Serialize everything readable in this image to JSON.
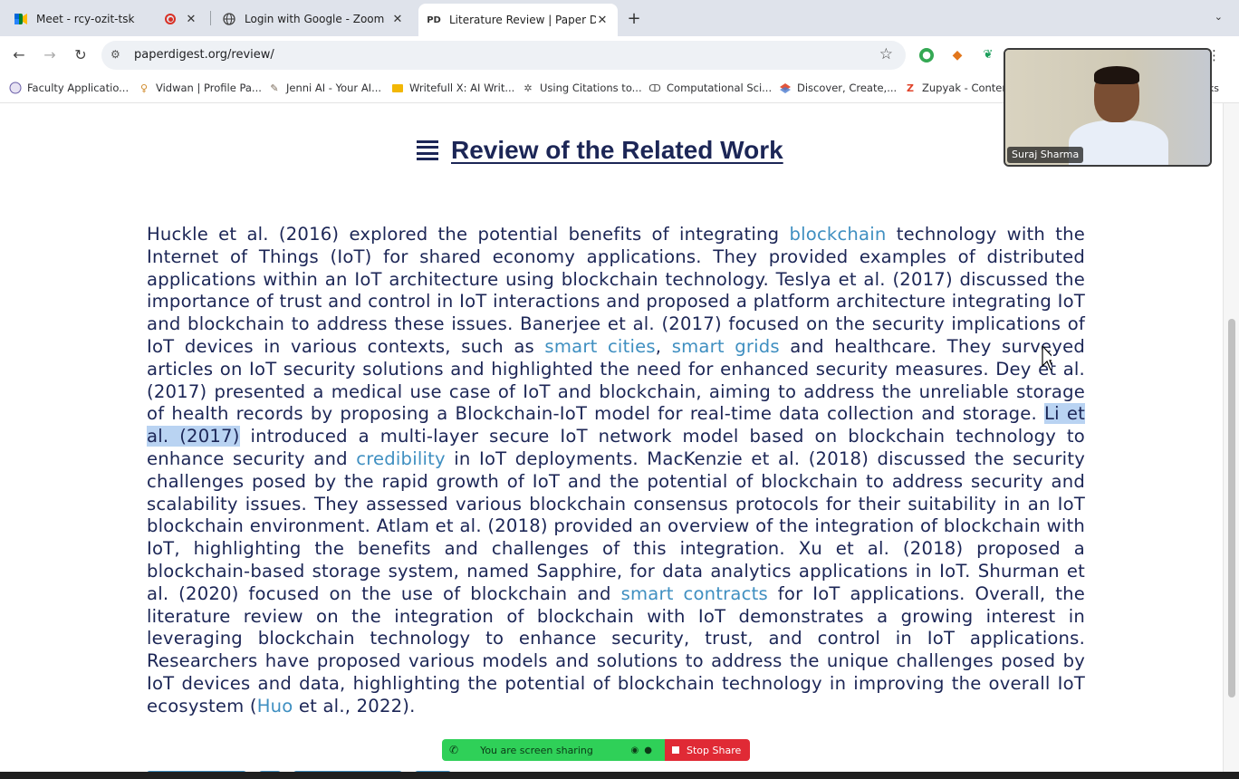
{
  "tabs": [
    {
      "title": "Meet - rcy-ozit-tsk",
      "recording": true
    },
    {
      "title": "Login with Google - Zoom"
    },
    {
      "title": "Literature Review | Paper Dige",
      "favicon": "PD"
    }
  ],
  "address": {
    "url": "paperdigest.org/review/"
  },
  "bookmarks": [
    {
      "label": "Faculty Applicatio..."
    },
    {
      "label": "Vidwan | Profile Pa..."
    },
    {
      "label": "Jenni AI - Your AI..."
    },
    {
      "label": "Writefull X: AI Writ..."
    },
    {
      "label": "Using Citations to..."
    },
    {
      "label": "Computational Sci..."
    },
    {
      "label": "Discover, Create,..."
    },
    {
      "label": "Zupyak - Conten"
    }
  ],
  "bookmarks_more": "ks",
  "page": {
    "heading": "Review of the Related Work",
    "segments": {
      "s1": "Huckle et al. (2016) explored the potential benefits of integrating ",
      "l1": "blockchain",
      "s2": " technology with the Internet of Things (IoT) for shared economy applications. They provided examples of distributed applications within an IoT architecture using blockchain technology. Teslya et al. (2017) discussed the importance of trust and control in IoT interactions and proposed a platform architecture integrating IoT and blockchain to address these issues. Banerjee et al. (2017) focused on the security implications of IoT devices in various contexts, such as ",
      "l2": "smart cities",
      "s3": ", ",
      "l3": "smart grids",
      "s4": " and healthcare. They surveyed articles on IoT security solutions and highlighted the need for enhanced security measures. Dey et al. (2017) presented a medical use case of IoT and blockchain, aiming to address the unreliable storage of health records by proposing a Blockchain-IoT model for real-time data collection and storage. ",
      "h1": "Li et al. (2017)",
      "s5": " introduced a multi-layer secure IoT network model based on blockchain technology to enhance security and ",
      "l4": "credibility",
      "s6": " in IoT deployments. MacKenzie et al. (2018) discussed the security challenges posed by the rapid growth of IoT and the potential of blockchain to address security and scalability issues. They assessed various blockchain consensus protocols for their suitability in an IoT blockchain environment. Atlam et al. (2018) provided an overview of the integration of blockchain with IoT, highlighting the benefits and challenges of this integration. Xu et al. (2018) proposed a blockchain-based storage system, named Sapphire, for data analytics applications in IoT. Shurman et al. (2020) focused on the use of blockchain and ",
      "l5": "smart contracts",
      "s7": " for IoT applications. Overall, the literature review on the integration of blockchain with IoT demonstrates a growing interest in leveraging blockchain technology to enhance security, trust, and control in IoT applications. Researchers have proposed various models and solutions to address the unique challenges posed by IoT devices and data, highlighting the potential of blockchain technology in improving the overall IoT ecosystem (",
      "l6": "Huo",
      "s8": " et al., 2022)."
    }
  },
  "screen_share": {
    "status": "You are screen sharing",
    "stop_label": "Stop Share"
  },
  "video": {
    "participant_name": "Suraj Sharma"
  },
  "colors": {
    "heading": "#1c2656",
    "link": "#3f8fc1",
    "share_green": "#2fd058",
    "share_red": "#e02a35"
  }
}
